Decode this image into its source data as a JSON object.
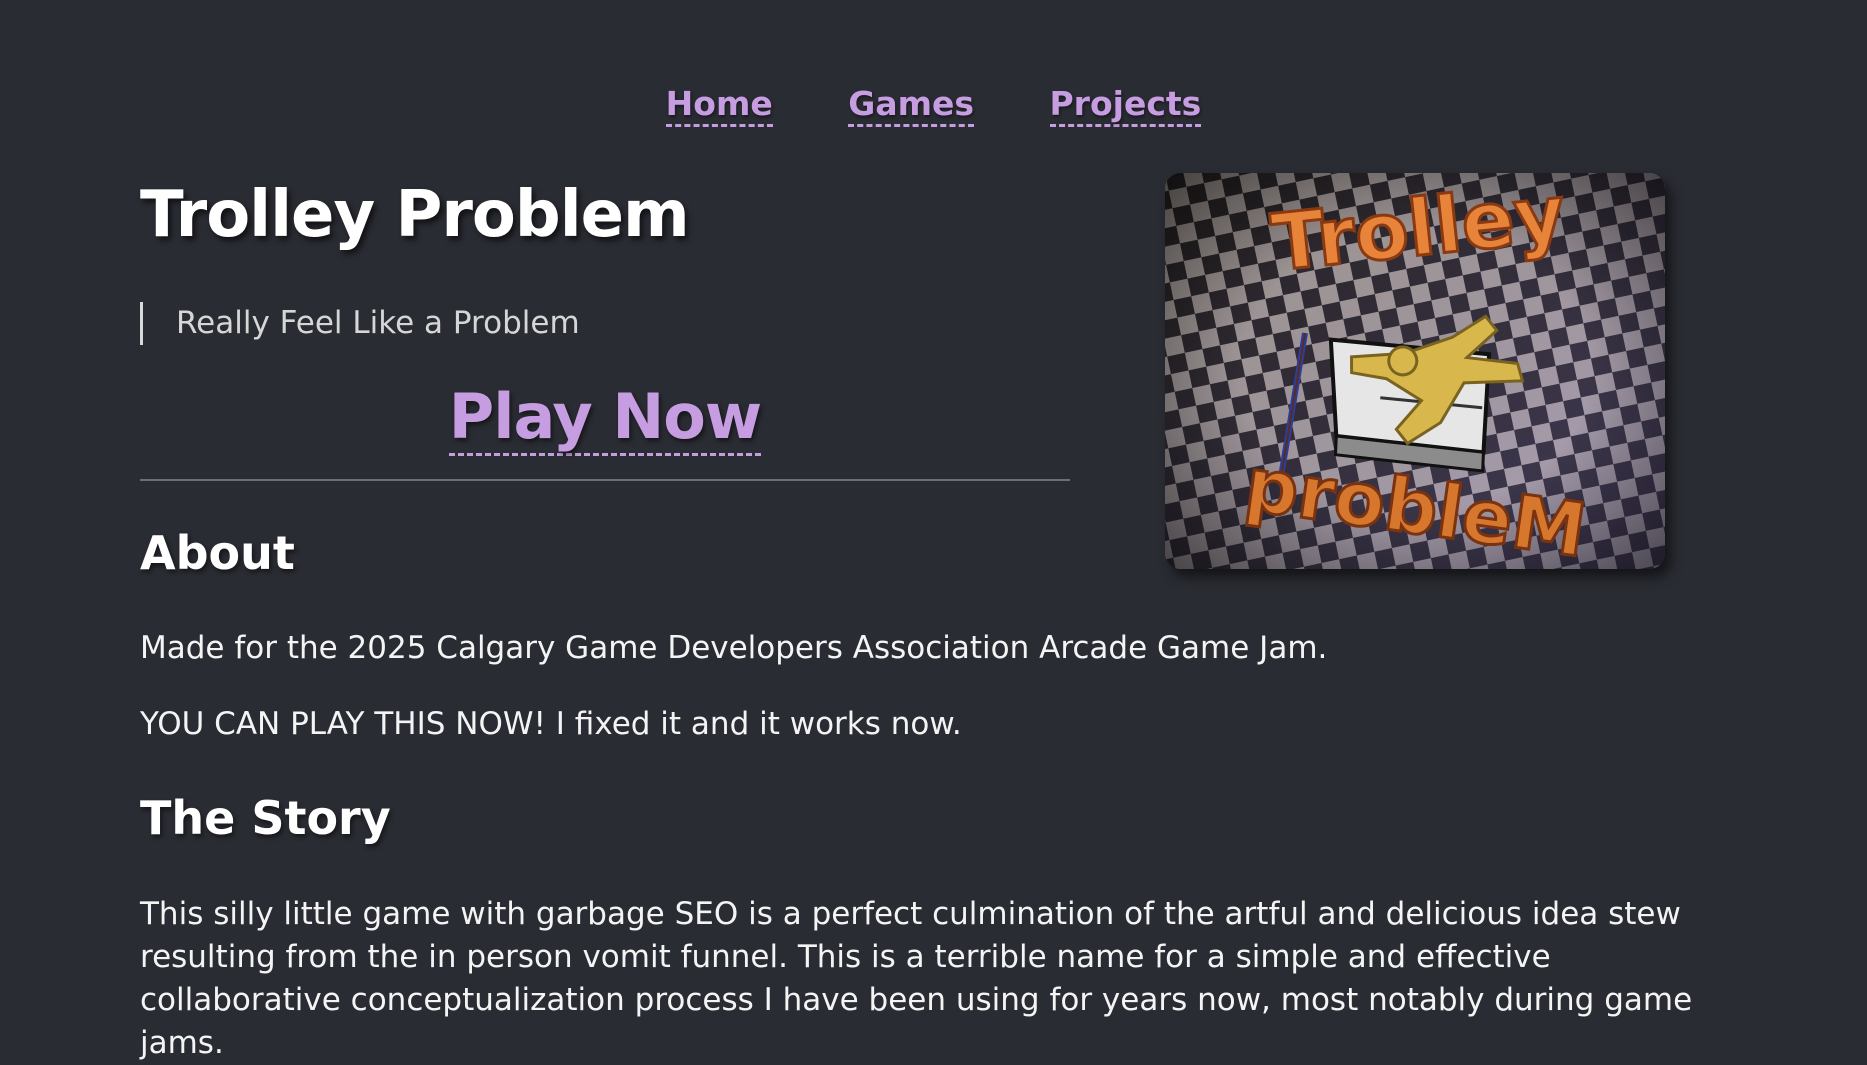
{
  "nav": {
    "items": [
      "Home",
      "Games",
      "Projects"
    ]
  },
  "page": {
    "title": "Trolley Problem",
    "subtitle": "Really Feel Like a Problem",
    "play_label": "Play Now"
  },
  "cover": {
    "top_text": "Trolley",
    "bottom_text": "probleM",
    "colors": {
      "title_orange": "#e8843a",
      "floor_dark": "#1f1f22",
      "floor_light": "#b9b3ad",
      "figure_yellow": "#d8b84c"
    }
  },
  "about": {
    "heading": "About",
    "p1": "Made for the 2025 Calgary Game Developers Association Arcade Game Jam.",
    "p2": "YOU CAN PLAY THIS NOW! I fixed it and it works now."
  },
  "story": {
    "heading": "The Story",
    "p1": "This silly little game with garbage SEO is a perfect culmination of the artful and delicious idea stew resulting from the in person vomit funnel. This is a terrible name for a simple and effective collaborative conceptualization process I have been using for years now, most notably during game jams."
  },
  "theme": {
    "background": "#2a2c33",
    "link": "#c79de1",
    "text": "#f2f2f2"
  }
}
